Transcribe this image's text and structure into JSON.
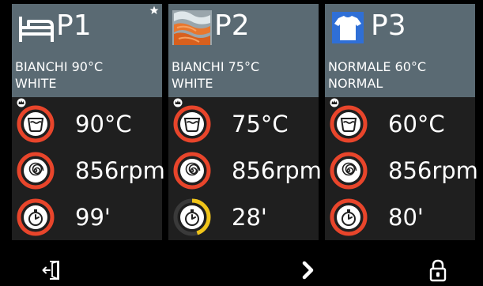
{
  "programs": [
    {
      "name": "P1",
      "icon": "bed-icon",
      "favorite": true,
      "line1": "BIANCHI 90°C",
      "line2": "WHITE",
      "temperature": "90°C",
      "speed": "856rpm",
      "time": "99'",
      "time_progress": 1.0,
      "time_ring_color": "#e8452b"
    },
    {
      "name": "P2",
      "icon": "towels-photo-icon",
      "favorite": false,
      "line1": "BIANCHI 75°C",
      "line2": "WHITE",
      "temperature": "75°C",
      "speed": "856rpm",
      "time": "28'",
      "time_progress": 0.45,
      "time_ring_color": "#f0c419"
    },
    {
      "name": "P3",
      "icon": "tshirt-icon",
      "favorite": false,
      "line1": "NORMALE 60°C",
      "line2": "NORMAL",
      "temperature": "60°C",
      "speed": "856rpm",
      "time": "80'",
      "time_progress": 1.0,
      "time_ring_color": "#e8452b"
    }
  ],
  "pager": {
    "count": 5,
    "active": 0
  },
  "colors": {
    "header": "#5a6a73",
    "card": "#1f1f1f",
    "ring": "#e8452b",
    "ring_time_partial": "#f0c419",
    "dot_active": "#19c3c3"
  },
  "bottom_bar": {
    "left_icon": "exit-door-icon",
    "center_icon": "chevron-right-icon",
    "right_icon": "lock-icon"
  }
}
